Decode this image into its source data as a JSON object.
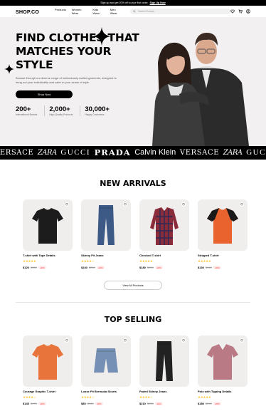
{
  "promo": {
    "text": "Sign up and get 20% off to your first order.",
    "link": "Sign Up Now"
  },
  "header": {
    "logo": "SHOP.CO",
    "nav": [
      "Products",
      "Women Wear",
      "Kids Wear",
      "Men Wear"
    ],
    "search_placeholder": "Search Product..."
  },
  "hero": {
    "title": "FIND CLOTHES THAT MATCHES YOUR STYLE",
    "description": "Browse through our diverse range of meticulously crafted garments, designed to bring out your individuality and cater to your sense of style.",
    "cta": "Shop Now",
    "stats": [
      {
        "value": "200+",
        "label": "International Brands"
      },
      {
        "value": "2,000+",
        "label": "High-Quality Products"
      },
      {
        "value": "30,000+",
        "label": "Happy Customers"
      }
    ]
  },
  "brands": [
    "VERSACE",
    "ZARA",
    "GUCCI",
    "PRADA",
    "Calvin Klein",
    "VERSACE",
    "ZARA",
    "GUCCI"
  ],
  "new_arrivals": {
    "title": "NEW ARRIVALS",
    "view_all": "View All Products",
    "products": [
      {
        "name": "T-shirt with Tape Details",
        "stars": "★★★★★",
        "price": "$120",
        "old": "$150",
        "off": "-20%",
        "color": "#1c1c1c",
        "kind": "tshirt"
      },
      {
        "name": "Skinny Fit Jeans",
        "stars": "★★★★☆",
        "price": "$240",
        "old": "$260",
        "off": "-20%",
        "color": "#3d5a86",
        "kind": "jeans"
      },
      {
        "name": "Checked T-shirt",
        "stars": "★★★★★",
        "price": "$180",
        "old": "$200",
        "off": "-20%",
        "color": "#8b2c3a",
        "kind": "shirt"
      },
      {
        "name": "Stripped T-shirt",
        "stars": "★★★★★",
        "price": "$130",
        "old": "$160",
        "off": "-30%",
        "color": "#e8632d",
        "kind": "raglan"
      }
    ]
  },
  "top_selling": {
    "title": "TOP SELLING",
    "products": [
      {
        "name": "Courage Graphic T-shirt",
        "stars": "★★★★☆",
        "price": "$145",
        "old": "$170",
        "off": "-20%",
        "color": "#e8743b",
        "kind": "tshirt"
      },
      {
        "name": "Loose Fit Bermuda Shorts",
        "stars": "★★★★☆",
        "price": "$80",
        "old": "$100",
        "off": "-20%",
        "color": "#7590b4",
        "kind": "shorts"
      },
      {
        "name": "Faded Skinny Jeans",
        "stars": "★★★★☆",
        "price": "$210",
        "old": "$230",
        "off": "-20%",
        "color": "#222222",
        "kind": "jeans"
      },
      {
        "name": "Polo with Tipping Details",
        "stars": "★★★★★",
        "price": "$180",
        "old": "$200",
        "off": "-20%",
        "color": "#b97a86",
        "kind": "polo"
      }
    ]
  }
}
